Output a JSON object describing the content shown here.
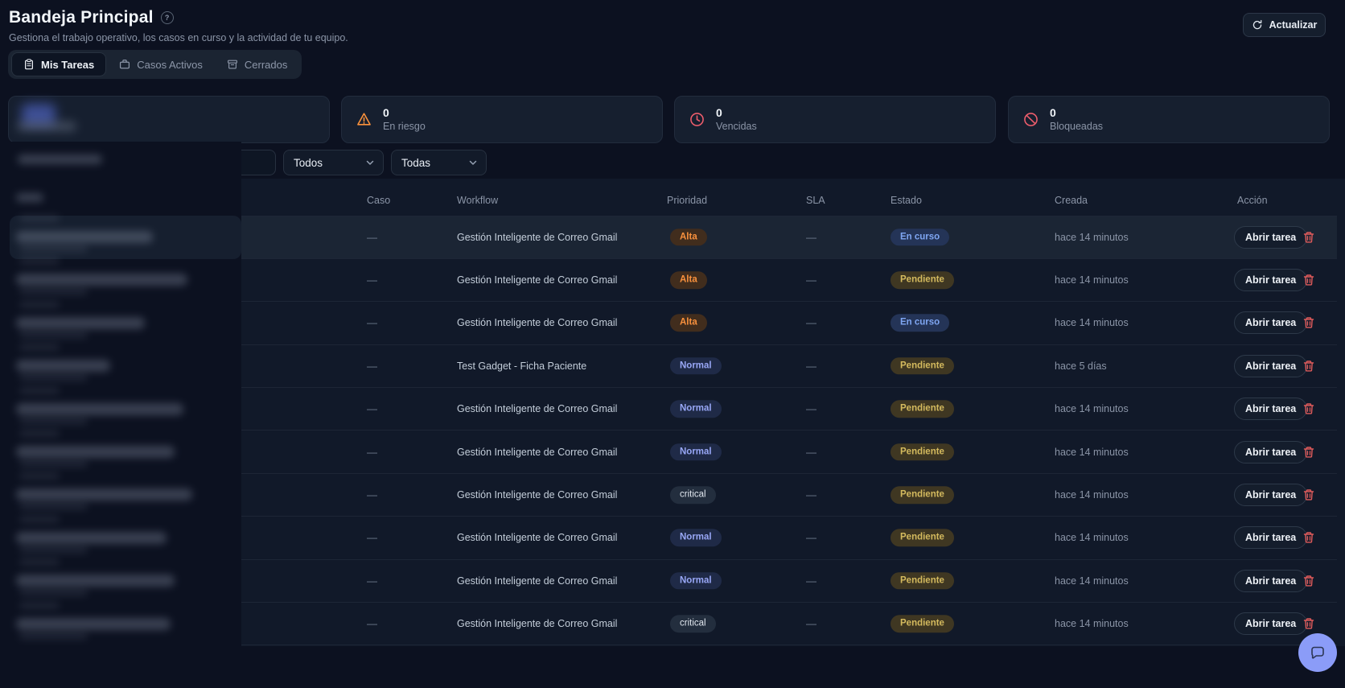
{
  "header": {
    "title": "Bandeja Principal",
    "subtitle": "Gestiona el trabajo operativo, los casos en curso y la actividad de tu equipo.",
    "refresh_label": "Actualizar"
  },
  "tabs": [
    {
      "label": "Mis Tareas",
      "icon": "clipboard-icon",
      "active": true
    },
    {
      "label": "Casos Activos",
      "icon": "briefcase-icon",
      "active": false
    },
    {
      "label": "Cerrados",
      "icon": "archive-icon",
      "active": false
    }
  ],
  "stats": [
    {
      "redacted": true
    },
    {
      "value": "0",
      "label": "En riesgo",
      "icon": "warning-triangle-icon",
      "icon_color": "#fb923c"
    },
    {
      "value": "0",
      "label": "Vencidas",
      "icon": "clock-icon",
      "icon_color": "#ee5d6c"
    },
    {
      "value": "0",
      "label": "Bloqueadas",
      "icon": "blocked-icon",
      "icon_color": "#ee5d6c"
    }
  ],
  "filters": {
    "dropdown_1": "Todos",
    "dropdown_2": "Todas"
  },
  "table": {
    "columns": [
      "Caso",
      "Workflow",
      "Prioridad",
      "SLA",
      "Estado",
      "Creada",
      "Acción"
    ],
    "action_label": "Abrir tarea",
    "rows": [
      {
        "caso": "—",
        "workflow": "Gestión Inteligente de Correo Gmail",
        "prioridad": "Alta",
        "sla": "—",
        "estado": "En curso",
        "creada": "hace 14 minutos"
      },
      {
        "caso": "—",
        "workflow": "Gestión Inteligente de Correo Gmail",
        "prioridad": "Alta",
        "sla": "—",
        "estado": "Pendiente",
        "creada": "hace 14 minutos"
      },
      {
        "caso": "—",
        "workflow": "Gestión Inteligente de Correo Gmail",
        "prioridad": "Alta",
        "sla": "—",
        "estado": "En curso",
        "creada": "hace 14 minutos"
      },
      {
        "caso": "—",
        "workflow": "Test Gadget - Ficha Paciente",
        "prioridad": "Normal",
        "sla": "—",
        "estado": "Pendiente",
        "creada": "hace 5 días"
      },
      {
        "caso": "—",
        "workflow": "Gestión Inteligente de Correo Gmail",
        "prioridad": "Normal",
        "sla": "—",
        "estado": "Pendiente",
        "creada": "hace 14 minutos"
      },
      {
        "caso": "—",
        "workflow": "Gestión Inteligente de Correo Gmail",
        "prioridad": "Normal",
        "sla": "—",
        "estado": "Pendiente",
        "creada": "hace 14 minutos"
      },
      {
        "caso": "—",
        "workflow": "Gestión Inteligente de Correo Gmail",
        "prioridad": "critical",
        "sla": "—",
        "estado": "Pendiente",
        "creada": "hace 14 minutos"
      },
      {
        "caso": "—",
        "workflow": "Gestión Inteligente de Correo Gmail",
        "prioridad": "Normal",
        "sla": "—",
        "estado": "Pendiente",
        "creada": "hace 14 minutos"
      },
      {
        "caso": "—",
        "workflow": "Gestión Inteligente de Correo Gmail",
        "prioridad": "Normal",
        "sla": "—",
        "estado": "Pendiente",
        "creada": "hace 14 minutos"
      },
      {
        "caso": "—",
        "workflow": "Gestión Inteligente de Correo Gmail",
        "prioridad": "critical",
        "sla": "—",
        "estado": "Pendiente",
        "creada": "hace 14 minutos"
      }
    ]
  },
  "badges": {
    "Alta": {
      "fg": "#f9913d",
      "bg": "#412d1d",
      "bold": true
    },
    "Normal": {
      "fg": "#98a7f6",
      "bg": "#1f2a47",
      "bold": true
    },
    "critical": {
      "fg": "#e2e8f0",
      "bg": "#232e3e",
      "bold": false
    },
    "En curso": {
      "fg": "#7fa6f2",
      "bg": "#243457",
      "bold": true
    },
    "Pendiente": {
      "fg": "#d4ba5e",
      "bg": "#3f3722",
      "bold": true
    }
  },
  "redacted_panel": {
    "visible_items": 10
  },
  "colors": {
    "accent": "#8b9cf8",
    "danger": "#e05b5b"
  }
}
